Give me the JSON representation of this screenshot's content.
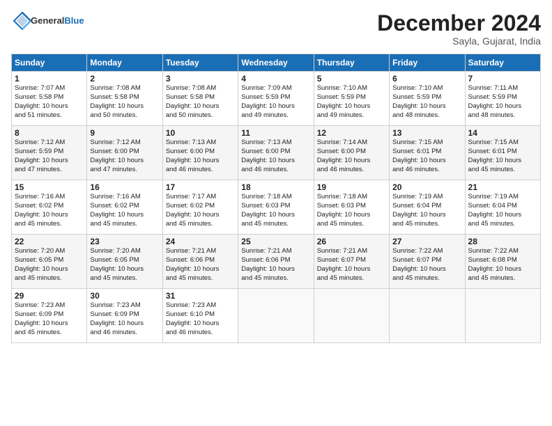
{
  "header": {
    "logo_general": "General",
    "logo_blue": "Blue",
    "month": "December 2024",
    "location": "Sayla, Gujarat, India"
  },
  "days_of_week": [
    "Sunday",
    "Monday",
    "Tuesday",
    "Wednesday",
    "Thursday",
    "Friday",
    "Saturday"
  ],
  "weeks": [
    [
      {
        "day": "1",
        "lines": [
          "Sunrise: 7:07 AM",
          "Sunset: 5:58 PM",
          "Daylight: 10 hours",
          "and 51 minutes."
        ]
      },
      {
        "day": "2",
        "lines": [
          "Sunrise: 7:08 AM",
          "Sunset: 5:58 PM",
          "Daylight: 10 hours",
          "and 50 minutes."
        ]
      },
      {
        "day": "3",
        "lines": [
          "Sunrise: 7:08 AM",
          "Sunset: 5:58 PM",
          "Daylight: 10 hours",
          "and 50 minutes."
        ]
      },
      {
        "day": "4",
        "lines": [
          "Sunrise: 7:09 AM",
          "Sunset: 5:59 PM",
          "Daylight: 10 hours",
          "and 49 minutes."
        ]
      },
      {
        "day": "5",
        "lines": [
          "Sunrise: 7:10 AM",
          "Sunset: 5:59 PM",
          "Daylight: 10 hours",
          "and 49 minutes."
        ]
      },
      {
        "day": "6",
        "lines": [
          "Sunrise: 7:10 AM",
          "Sunset: 5:59 PM",
          "Daylight: 10 hours",
          "and 48 minutes."
        ]
      },
      {
        "day": "7",
        "lines": [
          "Sunrise: 7:11 AM",
          "Sunset: 5:59 PM",
          "Daylight: 10 hours",
          "and 48 minutes."
        ]
      }
    ],
    [
      {
        "day": "8",
        "lines": [
          "Sunrise: 7:12 AM",
          "Sunset: 5:59 PM",
          "Daylight: 10 hours",
          "and 47 minutes."
        ]
      },
      {
        "day": "9",
        "lines": [
          "Sunrise: 7:12 AM",
          "Sunset: 6:00 PM",
          "Daylight: 10 hours",
          "and 47 minutes."
        ]
      },
      {
        "day": "10",
        "lines": [
          "Sunrise: 7:13 AM",
          "Sunset: 6:00 PM",
          "Daylight: 10 hours",
          "and 46 minutes."
        ]
      },
      {
        "day": "11",
        "lines": [
          "Sunrise: 7:13 AM",
          "Sunset: 6:00 PM",
          "Daylight: 10 hours",
          "and 46 minutes."
        ]
      },
      {
        "day": "12",
        "lines": [
          "Sunrise: 7:14 AM",
          "Sunset: 6:00 PM",
          "Daylight: 10 hours",
          "and 46 minutes."
        ]
      },
      {
        "day": "13",
        "lines": [
          "Sunrise: 7:15 AM",
          "Sunset: 6:01 PM",
          "Daylight: 10 hours",
          "and 46 minutes."
        ]
      },
      {
        "day": "14",
        "lines": [
          "Sunrise: 7:15 AM",
          "Sunset: 6:01 PM",
          "Daylight: 10 hours",
          "and 45 minutes."
        ]
      }
    ],
    [
      {
        "day": "15",
        "lines": [
          "Sunrise: 7:16 AM",
          "Sunset: 6:02 PM",
          "Daylight: 10 hours",
          "and 45 minutes."
        ]
      },
      {
        "day": "16",
        "lines": [
          "Sunrise: 7:16 AM",
          "Sunset: 6:02 PM",
          "Daylight: 10 hours",
          "and 45 minutes."
        ]
      },
      {
        "day": "17",
        "lines": [
          "Sunrise: 7:17 AM",
          "Sunset: 6:02 PM",
          "Daylight: 10 hours",
          "and 45 minutes."
        ]
      },
      {
        "day": "18",
        "lines": [
          "Sunrise: 7:18 AM",
          "Sunset: 6:03 PM",
          "Daylight: 10 hours",
          "and 45 minutes."
        ]
      },
      {
        "day": "19",
        "lines": [
          "Sunrise: 7:18 AM",
          "Sunset: 6:03 PM",
          "Daylight: 10 hours",
          "and 45 minutes."
        ]
      },
      {
        "day": "20",
        "lines": [
          "Sunrise: 7:19 AM",
          "Sunset: 6:04 PM",
          "Daylight: 10 hours",
          "and 45 minutes."
        ]
      },
      {
        "day": "21",
        "lines": [
          "Sunrise: 7:19 AM",
          "Sunset: 6:04 PM",
          "Daylight: 10 hours",
          "and 45 minutes."
        ]
      }
    ],
    [
      {
        "day": "22",
        "lines": [
          "Sunrise: 7:20 AM",
          "Sunset: 6:05 PM",
          "Daylight: 10 hours",
          "and 45 minutes."
        ]
      },
      {
        "day": "23",
        "lines": [
          "Sunrise: 7:20 AM",
          "Sunset: 6:05 PM",
          "Daylight: 10 hours",
          "and 45 minutes."
        ]
      },
      {
        "day": "24",
        "lines": [
          "Sunrise: 7:21 AM",
          "Sunset: 6:06 PM",
          "Daylight: 10 hours",
          "and 45 minutes."
        ]
      },
      {
        "day": "25",
        "lines": [
          "Sunrise: 7:21 AM",
          "Sunset: 6:06 PM",
          "Daylight: 10 hours",
          "and 45 minutes."
        ]
      },
      {
        "day": "26",
        "lines": [
          "Sunrise: 7:21 AM",
          "Sunset: 6:07 PM",
          "Daylight: 10 hours",
          "and 45 minutes."
        ]
      },
      {
        "day": "27",
        "lines": [
          "Sunrise: 7:22 AM",
          "Sunset: 6:07 PM",
          "Daylight: 10 hours",
          "and 45 minutes."
        ]
      },
      {
        "day": "28",
        "lines": [
          "Sunrise: 7:22 AM",
          "Sunset: 6:08 PM",
          "Daylight: 10 hours",
          "and 45 minutes."
        ]
      }
    ],
    [
      {
        "day": "29",
        "lines": [
          "Sunrise: 7:23 AM",
          "Sunset: 6:09 PM",
          "Daylight: 10 hours",
          "and 45 minutes."
        ]
      },
      {
        "day": "30",
        "lines": [
          "Sunrise: 7:23 AM",
          "Sunset: 6:09 PM",
          "Daylight: 10 hours",
          "and 46 minutes."
        ]
      },
      {
        "day": "31",
        "lines": [
          "Sunrise: 7:23 AM",
          "Sunset: 6:10 PM",
          "Daylight: 10 hours",
          "and 46 minutes."
        ]
      },
      null,
      null,
      null,
      null
    ]
  ]
}
